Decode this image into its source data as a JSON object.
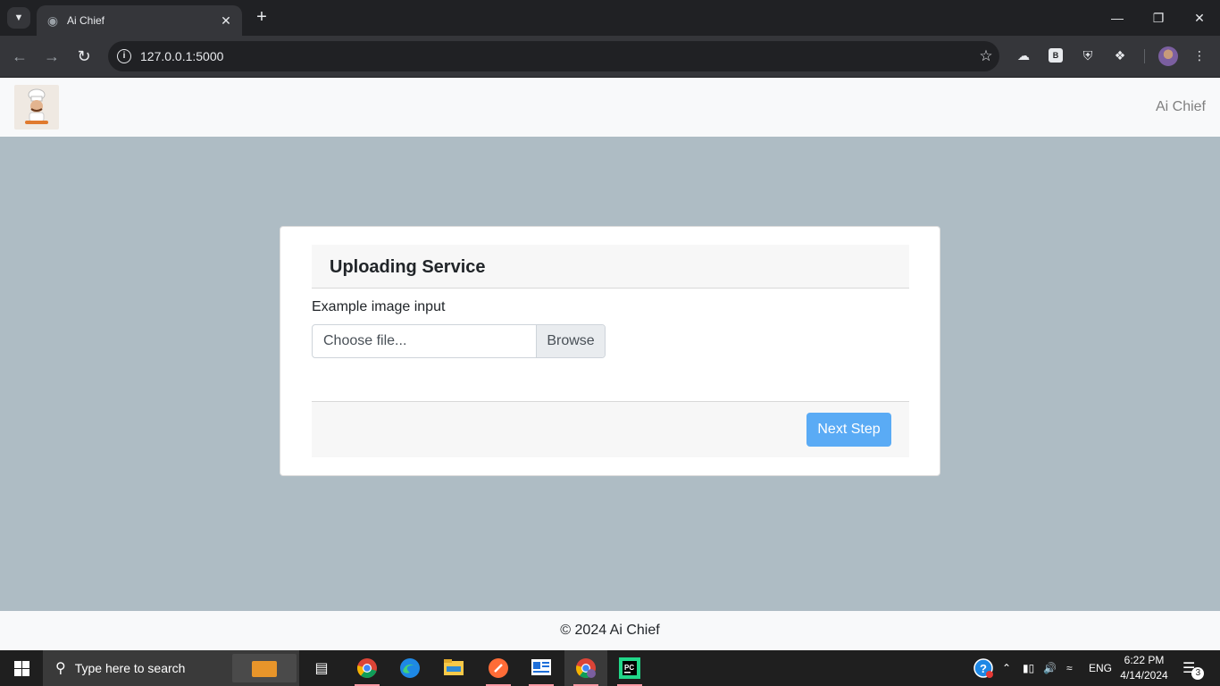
{
  "browser": {
    "tab_title": "Ai Chief",
    "url": "127.0.0.1:5000"
  },
  "navbar": {
    "brand": "Ai Chief"
  },
  "card": {
    "title": "Uploading Service",
    "field_label": "Example image input",
    "file_placeholder": "Choose file...",
    "browse_label": "Browse",
    "next_label": "Next Step"
  },
  "footer": {
    "text": "© 2024 Ai Chief"
  },
  "taskbar": {
    "search_placeholder": "Type here to search",
    "language": "ENG",
    "time": "6:22 PM",
    "date": "4/14/2024",
    "notification_count": "3"
  },
  "colors": {
    "page_background": "#aebcc4",
    "primary_button": "#5aabf5"
  }
}
